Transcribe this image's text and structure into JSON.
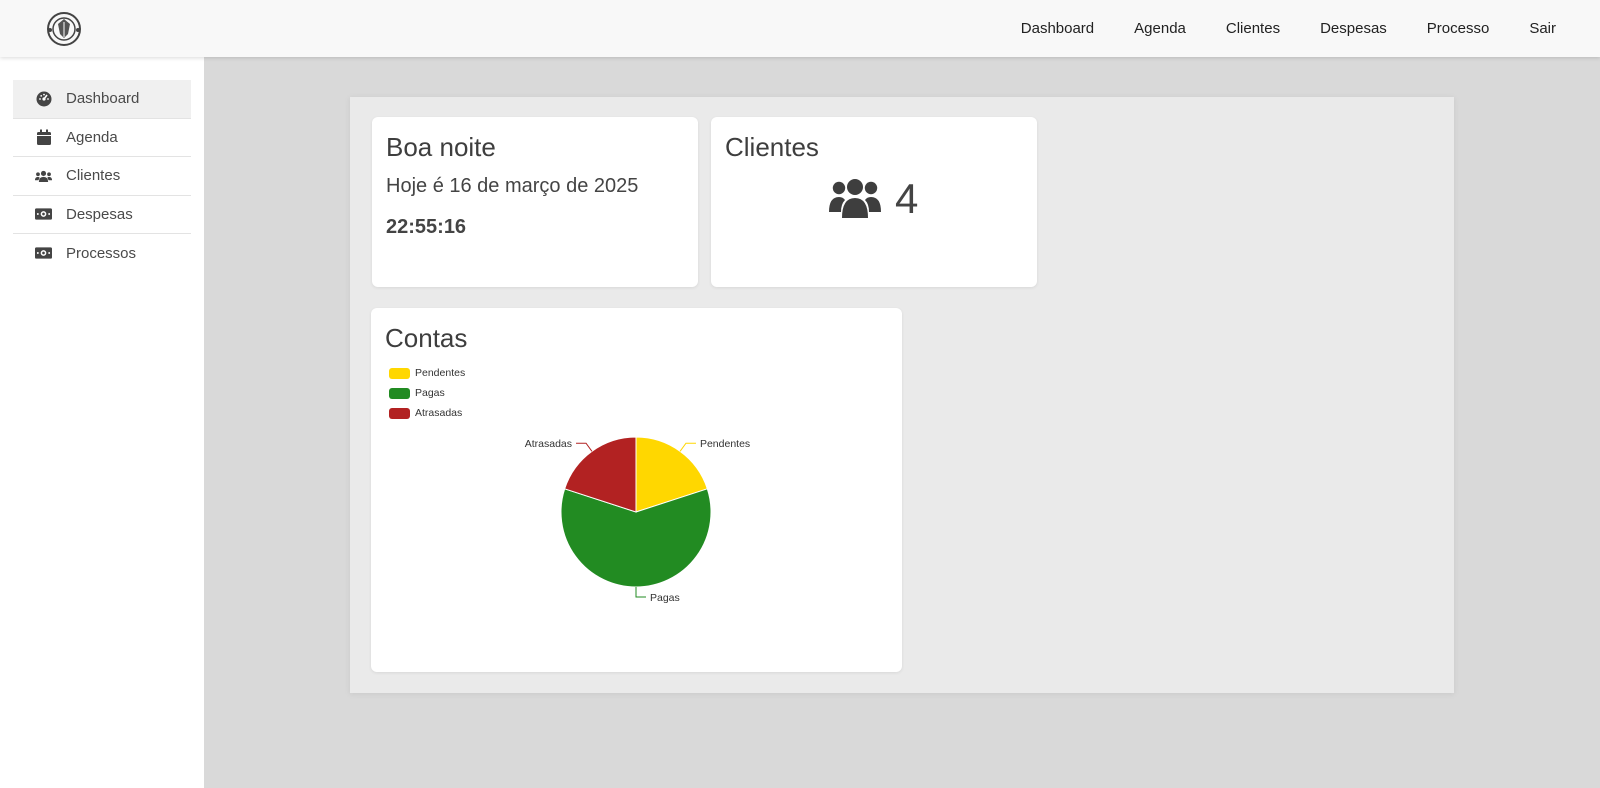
{
  "topnav": {
    "items": [
      {
        "label": "Dashboard"
      },
      {
        "label": "Agenda"
      },
      {
        "label": "Clientes"
      },
      {
        "label": "Despesas"
      },
      {
        "label": "Processo"
      },
      {
        "label": "Sair"
      }
    ]
  },
  "sidebar": {
    "items": [
      {
        "label": "Dashboard",
        "icon": "gauge-icon"
      },
      {
        "label": "Agenda",
        "icon": "calendar-icon"
      },
      {
        "label": "Clientes",
        "icon": "users-icon"
      },
      {
        "label": "Despesas",
        "icon": "money-bill-icon"
      },
      {
        "label": "Processos",
        "icon": "money-bill-icon"
      }
    ]
  },
  "greeting": {
    "title": "Boa noite",
    "date": "Hoje é 16 de março de 2025",
    "time": "22:55:16"
  },
  "clients": {
    "title": "Clientes",
    "count": "4"
  },
  "contas": {
    "title": "Contas"
  },
  "colors": {
    "pendentes": "#FFD700",
    "pagas": "#228B22",
    "atrasadas": "#B22222"
  },
  "chart_data": {
    "type": "pie",
    "categories": [
      "Pendentes",
      "Pagas",
      "Atrasadas"
    ],
    "values": [
      1,
      3,
      1
    ],
    "colors": [
      "#FFD700",
      "#228B22",
      "#B22222"
    ],
    "legend_position": "top-left"
  }
}
